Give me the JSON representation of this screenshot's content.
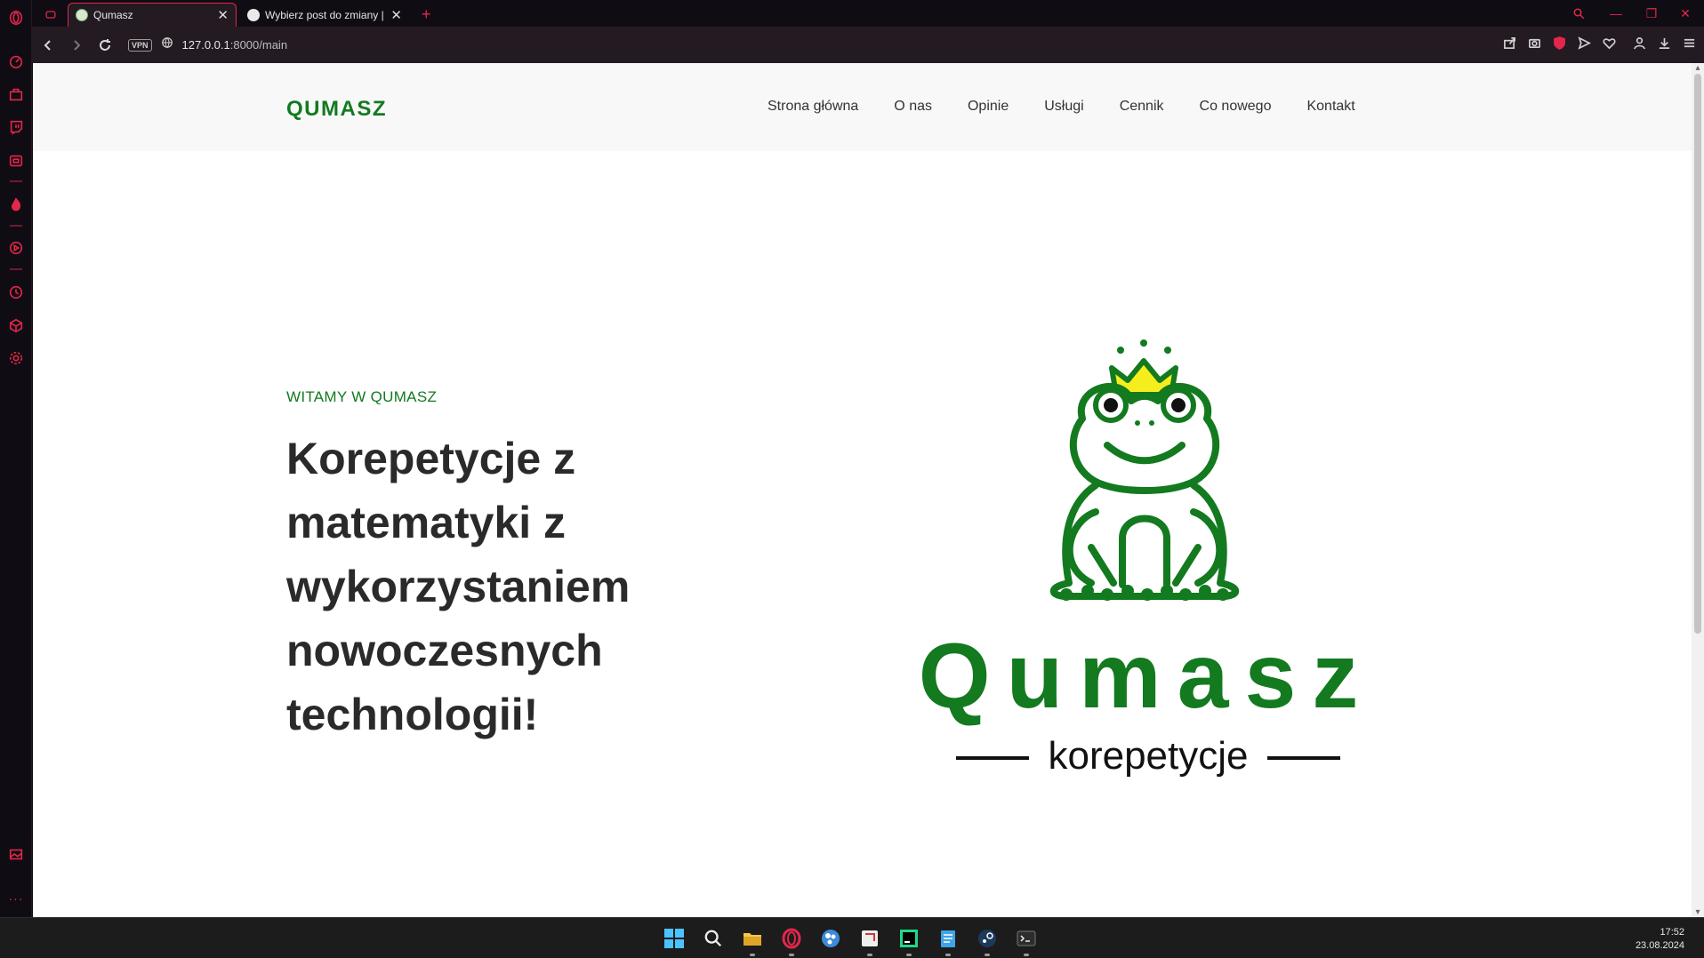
{
  "browser": {
    "tabs": [
      {
        "title": "Qumasz",
        "active": true
      },
      {
        "title": "Wybierz post do zmiany | /",
        "active": false
      }
    ],
    "new_tab_label": "+",
    "vpn_label": "VPN",
    "url_host": "127.0.0.1",
    "url_path": ":8000/main"
  },
  "site": {
    "brand": "QUMASZ",
    "nav": [
      "Strona główna",
      "O nas",
      "Opinie",
      "Usługi",
      "Cennik",
      "Co nowego",
      "Kontakt"
    ],
    "hero": {
      "kicker": "WITAMY W QUMASZ",
      "title": "Korepetycje z matematyki z wykorzystaniem nowoczesnych technologii!"
    },
    "logo": {
      "wordmark": "Qumasz",
      "tagline": "korepetycje"
    }
  },
  "taskbar": {
    "time": "17:52",
    "date": "23.08.2024"
  },
  "colors": {
    "brand_green": "#137a1f",
    "opera_red": "#e2274a",
    "crown_yellow": "#f5ee1c"
  }
}
